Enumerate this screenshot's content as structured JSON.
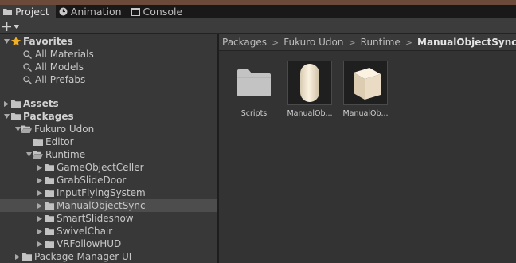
{
  "tabs": [
    {
      "label": "Project",
      "icon": "folder-icon",
      "active": true
    },
    {
      "label": "Animation",
      "icon": "animation-clock-icon",
      "active": false
    },
    {
      "label": "Console",
      "icon": "console-icon",
      "active": false
    }
  ],
  "toolbar": {
    "create_label": "+",
    "create_icon": "plus-icon"
  },
  "tree": {
    "favorites": {
      "label": "Favorites",
      "items": [
        "All Materials",
        "All Models",
        "All Prefabs"
      ]
    },
    "assets": {
      "label": "Assets"
    },
    "packages": {
      "label": "Packages"
    },
    "fukuro_udon": {
      "label": "Fukuro Udon"
    },
    "editor": {
      "label": "Editor"
    },
    "runtime": {
      "label": "Runtime"
    },
    "runtime_children": [
      "GameObjectCeller",
      "GrabSlideDoor",
      "InputFlyingSystem",
      "ManualObjectSync",
      "SmartSlideshow",
      "SwivelChair",
      "VRFollowHUD"
    ],
    "selected": "ManualObjectSync",
    "package_manager_ui": {
      "label": "Package Manager UI"
    }
  },
  "breadcrumb": [
    "Packages",
    "Fukuro Udon",
    "Runtime",
    "ManualObjectSync"
  ],
  "assets": [
    {
      "label": "Scripts",
      "icon": "folder-icon"
    },
    {
      "label": "ManualOb...",
      "icon": "capsule-prefab-icon"
    },
    {
      "label": "ManualOb...",
      "icon": "cube-prefab-icon"
    }
  ],
  "colors": {
    "favorite_star": "#f0b02a",
    "selection": "#4d4d4d"
  }
}
